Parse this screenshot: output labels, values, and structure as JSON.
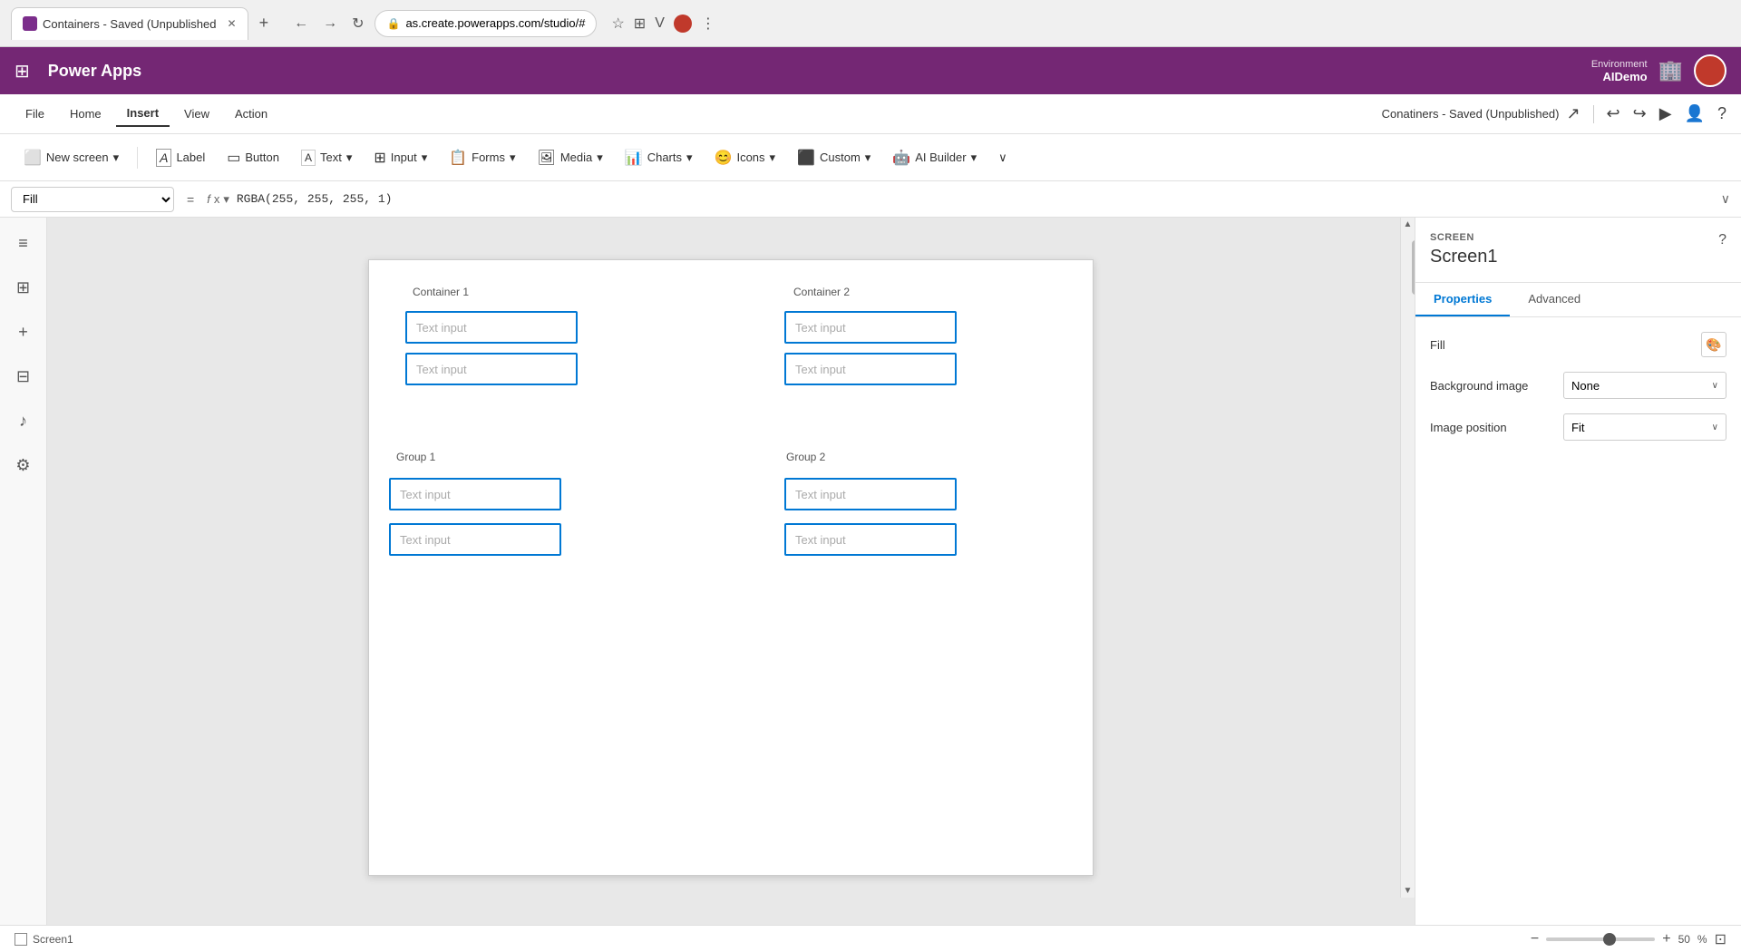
{
  "browser": {
    "tab_title": "Containers - Saved (Unpublished",
    "url": "as.create.powerapps.com/studio/#",
    "new_tab_label": "+"
  },
  "app": {
    "grid_icon": "⊞",
    "title": "Power Apps",
    "env_label": "Environment",
    "env_name": "AIDemo"
  },
  "menu": {
    "items": [
      {
        "label": "File",
        "active": false
      },
      {
        "label": "Home",
        "active": false
      },
      {
        "label": "Insert",
        "active": true
      },
      {
        "label": "View",
        "active": false
      },
      {
        "label": "Action",
        "active": false
      }
    ],
    "doc_title": "Conatiners - Saved (Unpublished)"
  },
  "toolbar": {
    "items": [
      {
        "label": "New screen",
        "icon": "⬜"
      },
      {
        "label": "Label",
        "icon": "🏷"
      },
      {
        "label": "Button",
        "icon": "⬛"
      },
      {
        "label": "Text",
        "icon": "T"
      },
      {
        "label": "Input",
        "icon": "☰"
      },
      {
        "label": "Forms",
        "icon": "📋"
      },
      {
        "label": "Media",
        "icon": "🖼"
      },
      {
        "label": "Charts",
        "icon": "📊"
      },
      {
        "label": "Icons",
        "icon": "😊"
      },
      {
        "label": "Custom",
        "icon": "⬛"
      },
      {
        "label": "AI Builder",
        "icon": "🤖"
      }
    ],
    "more_icon": "∨"
  },
  "formula_bar": {
    "property": "Fill",
    "fx_label": "fx",
    "formula": "RGBA(255, 255, 255, 1)"
  },
  "canvas": {
    "containers": [
      {
        "id": "container1",
        "label": "Container 1",
        "inputs": [
          {
            "placeholder": "Text input"
          },
          {
            "placeholder": "Text input"
          }
        ]
      },
      {
        "id": "container2",
        "label": "Container 2",
        "inputs": [
          {
            "placeholder": "Text input"
          },
          {
            "placeholder": "Text input"
          }
        ]
      }
    ],
    "groups": [
      {
        "id": "group1",
        "label": "Group 1",
        "inputs": [
          {
            "placeholder": "Text input"
          },
          {
            "placeholder": "Text input"
          }
        ]
      },
      {
        "id": "group2",
        "label": "Group 2",
        "inputs": [
          {
            "placeholder": "Text input"
          },
          {
            "placeholder": "Text input"
          }
        ]
      }
    ]
  },
  "right_panel": {
    "section_label": "SCREEN",
    "title": "Screen1",
    "tabs": [
      {
        "label": "Properties",
        "active": true
      },
      {
        "label": "Advanced",
        "active": false
      }
    ],
    "help_icon": "?",
    "properties": {
      "fill_label": "Fill",
      "bg_image_label": "Background image",
      "bg_image_value": "None",
      "image_position_label": "Image position",
      "image_position_value": "Fit"
    }
  },
  "footer": {
    "screen_label": "Screen1",
    "zoom_minus": "−",
    "zoom_plus": "+",
    "zoom_value": "50",
    "zoom_unit": "%"
  },
  "sidebar": {
    "icons": [
      "≡",
      "⊞",
      "+",
      "⊟",
      "♪",
      "⚙"
    ]
  }
}
